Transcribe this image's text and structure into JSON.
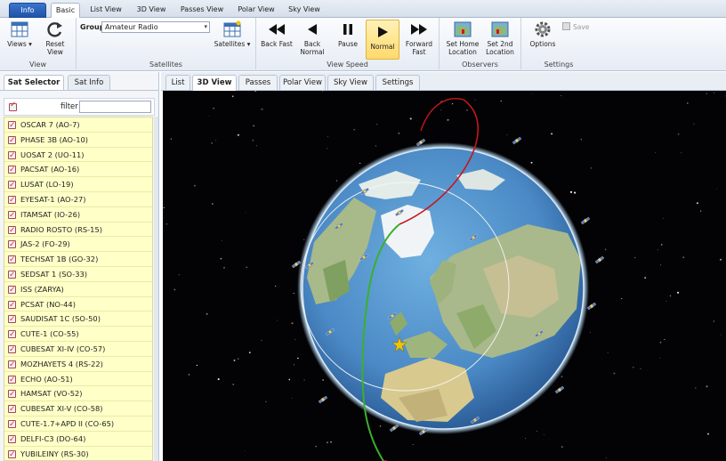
{
  "top_tabs": [
    "Info",
    "Basic",
    "List View",
    "3D View",
    "Passes View",
    "Polar View",
    "Sky View"
  ],
  "ribbon": {
    "view": {
      "views": "Views ▾",
      "reset_view": "Reset View",
      "label": "View"
    },
    "satellites": {
      "group_label": "Group",
      "group_value": "Amateur Radio",
      "satellites_btn": "Satellites ▾",
      "label": "Satellites"
    },
    "speed": {
      "back_fast": "Back Fast",
      "back_normal": "Back Normal",
      "pause": "Pause",
      "normal": "Normal",
      "forward_fast": "Forward Fast",
      "label": "View Speed"
    },
    "observers": {
      "set_home": "Set Home Location",
      "set_2nd": "Set 2nd Location",
      "label": "Observers"
    },
    "settings": {
      "options": "Options",
      "save": "Save",
      "label": "Settings"
    }
  },
  "left_tabs": [
    "Sat Selector",
    "Sat Info"
  ],
  "filter": {
    "label": "filter",
    "value": ""
  },
  "satellites": [
    "OSCAR 7 (AO-7)",
    "PHASE 3B (AO-10)",
    "UOSAT 2 (UO-11)",
    "PACSAT (AO-16)",
    "LUSAT (LO-19)",
    "EYESAT-1 (AO-27)",
    "ITAMSAT (IO-26)",
    "RADIO ROSTO (RS-15)",
    "JAS-2 (FO-29)",
    "TECHSAT 1B (GO-32)",
    "SEDSAT 1 (SO-33)",
    "ISS (ZARYA)",
    "PCSAT (NO-44)",
    "SAUDISAT 1C (SO-50)",
    "CUTE-1 (CO-55)",
    "CUBESAT XI-IV (CO-57)",
    "MOZHAYETS 4 (RS-22)",
    "ECHO (AO-51)",
    "HAMSAT (VO-52)",
    "CUBESAT XI-V (CO-58)",
    "CUTE-1.7+APD II (CO-65)",
    "DELFI-C3 (DO-64)",
    "YUBILEINY (RS-30)"
  ],
  "view_tabs": [
    "List",
    "3D View",
    "Passes",
    "Polar View",
    "Sky View",
    "Settings"
  ],
  "colors": {
    "orbit_red": "#c8151a",
    "orbit_green": "#3bb02b",
    "info_tab": "#2a62bb",
    "normal_active": "#ffd96b",
    "sat_list_bg": "#ffffc8"
  }
}
